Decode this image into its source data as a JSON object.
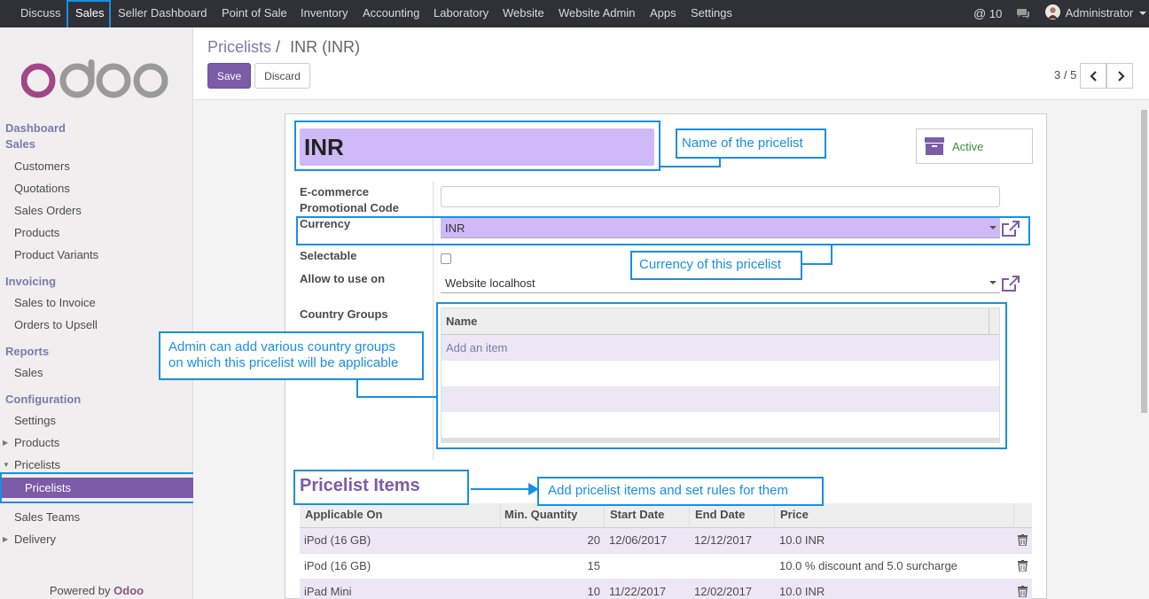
{
  "topbar": {
    "menu": [
      "Discuss",
      "Sales",
      "Seller Dashboard",
      "Point of Sale",
      "Inventory",
      "Accounting",
      "Laboratory",
      "Website",
      "Website Admin",
      "Apps",
      "Settings"
    ],
    "messages_count": "10",
    "user": "Administrator"
  },
  "sidebar": {
    "dashboard": "Dashboard",
    "sales_head": "Sales",
    "sales_items": [
      "Customers",
      "Quotations",
      "Sales Orders",
      "Products",
      "Product Variants"
    ],
    "invoicing_head": "Invoicing",
    "invoicing_items": [
      "Sales to Invoice",
      "Orders to Upsell"
    ],
    "reports_head": "Reports",
    "reports_items": [
      "Sales"
    ],
    "config_head": "Configuration",
    "config_items": [
      "Settings",
      "Products",
      "Pricelists",
      "Pricelists",
      "Sales Teams",
      "Delivery"
    ],
    "powered_prefix": "Powered by",
    "powered_brand": "Odoo"
  },
  "breadcrumb": {
    "parent": "Pricelists",
    "sep": "/",
    "current": "INR (INR)"
  },
  "buttons": {
    "save": "Save",
    "discard": "Discard"
  },
  "pager": {
    "value": "3 / 5"
  },
  "form": {
    "name": "INR",
    "status_button": "Active",
    "labels": {
      "ecommerce_line1": "E-commerce",
      "ecommerce_line2": "Promotional Code",
      "currency": "Currency",
      "selectable": "Selectable",
      "allow": "Allow to use on",
      "country_groups": "Country Groups"
    },
    "ecommerce_code": "",
    "currency": "INR",
    "selectable": false,
    "website": "Website localhost",
    "country_groups": {
      "header": "Name",
      "add": "Add an item"
    }
  },
  "pricelist_items": {
    "title": "Pricelist Items",
    "headers": [
      "Applicable On",
      "Min. Quantity",
      "Start Date",
      "End Date",
      "Price"
    ],
    "rows": [
      {
        "applicable": "iPod (16 GB)",
        "min_qty": "20",
        "start": "12/06/2017",
        "end": "12/12/2017",
        "price": "10.0 INR"
      },
      {
        "applicable": "iPod (16 GB)",
        "min_qty": "15",
        "start": "",
        "end": "",
        "price": "10.0 % discount and 5.0 surcharge"
      },
      {
        "applicable": "iPad Mini",
        "min_qty": "10",
        "start": "11/22/2017",
        "end": "12/02/2017",
        "price": "10.0 INR"
      }
    ]
  },
  "annotations": {
    "name": "Name of the pricelist",
    "currency": "Currency of this pricelist",
    "country_line1": "Admin can add various country groups",
    "country_line2": "on which this pricelist will be applicable",
    "items": "Add pricelist items and set rules for them"
  },
  "colors": {
    "brand": "#7c5ba7",
    "topbar": "#2f3136",
    "annotation": "#1a8fe0",
    "field_highlight": "#cfb9f8"
  }
}
